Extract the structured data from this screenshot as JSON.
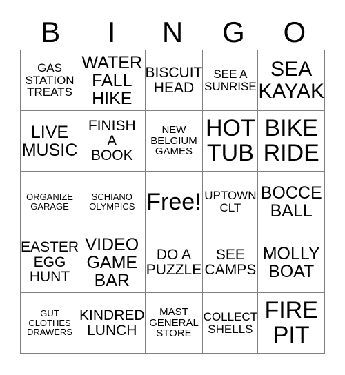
{
  "card": {
    "title": "BINGO",
    "header_letters": [
      "B",
      "I",
      "N",
      "G",
      "O"
    ],
    "columns": 5,
    "rows": 5,
    "free_space_label": "Free!",
    "free_space_index": 12,
    "colors": {
      "background": "#ffffff",
      "text": "#000000",
      "grid_line": "#808080"
    },
    "cells": [
      {
        "text": "GAS\nSTATION\nTREATS",
        "size": "fs-m",
        "column": "B",
        "row": 1
      },
      {
        "text": "WATER\nFALL\nHIKE",
        "size": "fs-xl",
        "column": "I",
        "row": 1
      },
      {
        "text": "BISCUIT\nHEAD",
        "size": "fs-l",
        "column": "N",
        "row": 1
      },
      {
        "text": "SEE A\nSUNRISE",
        "size": "fs-m",
        "column": "G",
        "row": 1
      },
      {
        "text": "SEA\nKAYAK",
        "size": "fs-xxl",
        "column": "O",
        "row": 1
      },
      {
        "text": "LIVE\nMUSIC",
        "size": "fs-xl",
        "column": "B",
        "row": 2
      },
      {
        "text": "FINISH\nA\nBOOK",
        "size": "fs-l",
        "column": "I",
        "row": 2
      },
      {
        "text": "NEW\nBELGIUM\nGAMES",
        "size": "fs-s",
        "column": "N",
        "row": 2
      },
      {
        "text": "HOT\nTUB",
        "size": "fs-max",
        "column": "G",
        "row": 2
      },
      {
        "text": "BIKE\nRIDE",
        "size": "fs-max",
        "column": "O",
        "row": 2
      },
      {
        "text": "ORGANIZE\nGARAGE",
        "size": "fs-xs",
        "column": "B",
        "row": 3
      },
      {
        "text": "SCHIANO\nOLYMPICS",
        "size": "fs-xs",
        "column": "I",
        "row": 3
      },
      {
        "text": "Free!",
        "size": "fs-max",
        "column": "N",
        "row": 3
      },
      {
        "text": "UPTOWN\nCLT",
        "size": "fs-m",
        "column": "G",
        "row": 3
      },
      {
        "text": "BOCCE\nBALL",
        "size": "fs-xl",
        "column": "O",
        "row": 3
      },
      {
        "text": "EASTER\nEGG\nHUNT",
        "size": "fs-l",
        "column": "B",
        "row": 4
      },
      {
        "text": "VIDEO\nGAME\nBAR",
        "size": "fs-xl",
        "column": "I",
        "row": 4
      },
      {
        "text": "DO A\nPUZZLE",
        "size": "fs-l",
        "column": "N",
        "row": 4
      },
      {
        "text": "SEE\nCAMPS",
        "size": "fs-l",
        "column": "G",
        "row": 4
      },
      {
        "text": "MOLLY\nBOAT",
        "size": "fs-xl",
        "column": "O",
        "row": 4
      },
      {
        "text": "GUT\nCLOTHES\nDRAWERS",
        "size": "fs-xs",
        "column": "B",
        "row": 5
      },
      {
        "text": "KINDRED\nLUNCH",
        "size": "fs-l",
        "column": "I",
        "row": 5
      },
      {
        "text": "MAST\nGENERAL\nSTORE",
        "size": "fs-s",
        "column": "N",
        "row": 5
      },
      {
        "text": "COLLECT\nSHELLS",
        "size": "fs-m",
        "column": "G",
        "row": 5
      },
      {
        "text": "FIRE\nPIT",
        "size": "fs-max",
        "column": "O",
        "row": 5
      }
    ]
  }
}
